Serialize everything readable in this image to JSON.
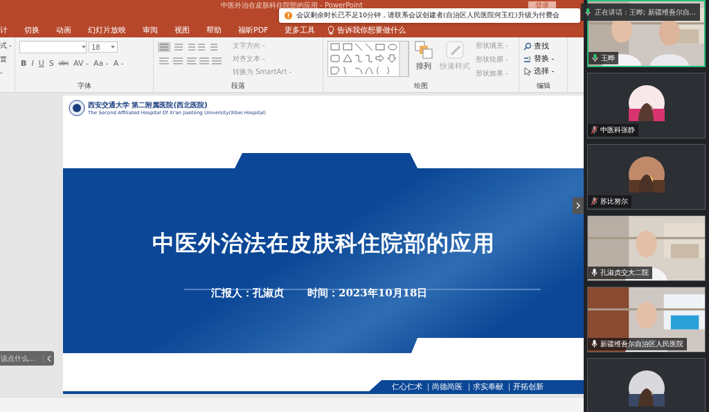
{
  "window": {
    "title": "中医外治在皮肤科住院部的应用 - PowerPoint",
    "login_button": "登录"
  },
  "tabs": [
    {
      "label": "计",
      "selected": false
    },
    {
      "label": "切换",
      "selected": false
    },
    {
      "label": "动画",
      "selected": false
    },
    {
      "label": "幻灯片放映",
      "selected": false
    },
    {
      "label": "审阅",
      "selected": false
    },
    {
      "label": "视图",
      "selected": false
    },
    {
      "label": "帮助",
      "selected": false
    },
    {
      "label": "福昕PDF",
      "selected": false
    },
    {
      "label": "更多工具",
      "selected": false
    }
  ],
  "tell_me": "告诉我你想要做什么",
  "ribbon": {
    "cut_group": [
      "式 -",
      "置",
      "-"
    ],
    "font": {
      "size": "18",
      "format_buttons": [
        "B",
        "I",
        "U",
        "S",
        "abc",
        "AV -",
        "Aa -",
        "A -"
      ],
      "label": "字体"
    },
    "paragraph": {
      "items": [
        "文字方向 -",
        "对齐文本 -",
        "转换为 SmartArt -"
      ],
      "label": "段落"
    },
    "drawing": {
      "arrange": "排列",
      "quick_styles": {
        "label": "快速样式",
        "disabled": true
      },
      "shape_options": [
        {
          "label": "形状填充 -",
          "disabled": true
        },
        {
          "label": "形状轮廓 -",
          "disabled": true
        },
        {
          "label": "形状效果 -",
          "disabled": true
        }
      ],
      "label": "绘图"
    },
    "editing": {
      "items": [
        {
          "label": "查找",
          "kind": "find"
        },
        {
          "label": "替换 -",
          "kind": "replace"
        },
        {
          "label": "选择 -",
          "kind": "select"
        }
      ],
      "label": "编辑"
    }
  },
  "slide": {
    "logo_name": "西安交通大学 第二附属医院(西北医院)",
    "logo_english": "The Second Affiliated Hospital Of Xi'an Jiaotong University(Xibei Hospital)",
    "title": "中医外治法在皮肤科住院部的应用",
    "reporter": "汇报人：孔淑贞",
    "date": "时间：2023年10月18日",
    "motto": "仁心仁术 ｜尚德尚医 ｜求实奉献 ｜开拓创新"
  },
  "chat": {
    "placeholder": "说点什么..."
  },
  "notification": {
    "icon": "!",
    "text": "会议剩余时长已不足10分钟，请联系会议创建者(自治区人民医院何玉红)升级为付费会"
  },
  "speaking": {
    "text": "正在讲话：王晔; 新疆维吾尔自..."
  },
  "participants": [
    {
      "name": "王晔",
      "kind": "video",
      "speaking": true,
      "muted": false
    },
    {
      "name": "中医科张静",
      "kind": "avatar",
      "speaking": false,
      "muted": true
    },
    {
      "name": "苏比努尔",
      "kind": "avatar",
      "speaking": false,
      "muted": true
    },
    {
      "name": "孔淑贞交大二院",
      "kind": "video",
      "speaking": false,
      "muted": false
    },
    {
      "name": "新疆维吾尔自治区人民医院",
      "kind": "video",
      "speaking": false,
      "muted": false
    },
    {
      "kind": "avatar",
      "speaking": false
    }
  ]
}
